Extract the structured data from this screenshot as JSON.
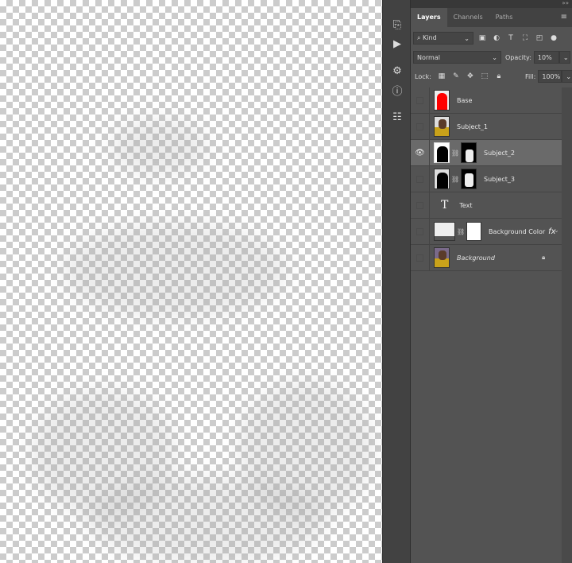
{
  "panel": {
    "tabs": [
      "Layers",
      "Channels",
      "Paths"
    ],
    "active_tab": "Layers",
    "filter": {
      "kind": "Kind"
    },
    "blend_mode": "Normal",
    "opacity_label": "Opacity:",
    "opacity": "10%",
    "lock_label": "Lock:",
    "fill_label": "Fill:",
    "fill": "100%"
  },
  "layers": [
    {
      "name": "Base",
      "visible": false
    },
    {
      "name": "Subject_1",
      "visible": false
    },
    {
      "name": "Subject_2",
      "visible": true,
      "selected": true
    },
    {
      "name": "Subject_3",
      "visible": false
    },
    {
      "name": "Text",
      "visible": false
    },
    {
      "name": "Background Color",
      "visible": false,
      "fx": "fx"
    },
    {
      "name": "Background",
      "visible": false,
      "locked": true
    }
  ],
  "icons": {
    "text_layer": "T",
    "collapse": "««",
    "expand": "»»"
  },
  "colors": {
    "panel": "#535353",
    "selected": "#6a6a6a",
    "base_thumb": "#ff0000"
  }
}
